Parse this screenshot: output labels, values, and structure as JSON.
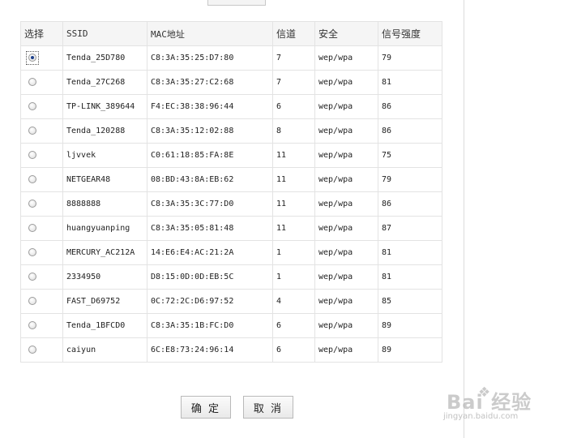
{
  "table": {
    "headers": [
      "选择",
      "SSID",
      "MAC地址",
      "信道",
      "安全",
      "信号强度"
    ],
    "rows": [
      {
        "selected": true,
        "ssid": "Tenda_25D780",
        "mac": "C8:3A:35:25:D7:80",
        "channel": "7",
        "security": "wep/wpa",
        "signal": "79"
      },
      {
        "selected": false,
        "ssid": "Tenda_27C268",
        "mac": "C8:3A:35:27:C2:68",
        "channel": "7",
        "security": "wep/wpa",
        "signal": "81"
      },
      {
        "selected": false,
        "ssid": "TP-LINK_389644",
        "mac": "F4:EC:38:38:96:44",
        "channel": "6",
        "security": "wep/wpa",
        "signal": "86"
      },
      {
        "selected": false,
        "ssid": "Tenda_120288",
        "mac": "C8:3A:35:12:02:88",
        "channel": "8",
        "security": "wep/wpa",
        "signal": "86"
      },
      {
        "selected": false,
        "ssid": "ljvvek",
        "mac": "C0:61:18:85:FA:8E",
        "channel": "11",
        "security": "wep/wpa",
        "signal": "75"
      },
      {
        "selected": false,
        "ssid": "NETGEAR48",
        "mac": "08:BD:43:8A:EB:62",
        "channel": "11",
        "security": "wep/wpa",
        "signal": "79"
      },
      {
        "selected": false,
        "ssid": "8888888",
        "mac": "C8:3A:35:3C:77:D0",
        "channel": "11",
        "security": "wep/wpa",
        "signal": "86"
      },
      {
        "selected": false,
        "ssid": "huangyuanping",
        "mac": "C8:3A:35:05:81:48",
        "channel": "11",
        "security": "wep/wpa",
        "signal": "87"
      },
      {
        "selected": false,
        "ssid": "MERCURY_AC212A",
        "mac": "14:E6:E4:AC:21:2A",
        "channel": "1",
        "security": "wep/wpa",
        "signal": "81"
      },
      {
        "selected": false,
        "ssid": "2334950",
        "mac": "D8:15:0D:0D:EB:5C",
        "channel": "1",
        "security": "wep/wpa",
        "signal": "81"
      },
      {
        "selected": false,
        "ssid": "FAST_D69752",
        "mac": "0C:72:2C:D6:97:52",
        "channel": "4",
        "security": "wep/wpa",
        "signal": "85"
      },
      {
        "selected": false,
        "ssid": "Tenda_1BFCD0",
        "mac": "C8:3A:35:1B:FC:D0",
        "channel": "6",
        "security": "wep/wpa",
        "signal": "89"
      },
      {
        "selected": false,
        "ssid": "caiyun",
        "mac": "6C:E8:73:24:96:14",
        "channel": "6",
        "security": "wep/wpa",
        "signal": "89"
      }
    ]
  },
  "buttons": {
    "confirm_label": "确 定",
    "cancel_label": "取 消"
  },
  "watermark": {
    "text": "Bai  经验",
    "url": "jingyan.baidu.com"
  },
  "colors": {
    "header_bg": "#f5f5f5",
    "border": "#e3e3e3",
    "radio_dot": "#1c3f8a"
  }
}
